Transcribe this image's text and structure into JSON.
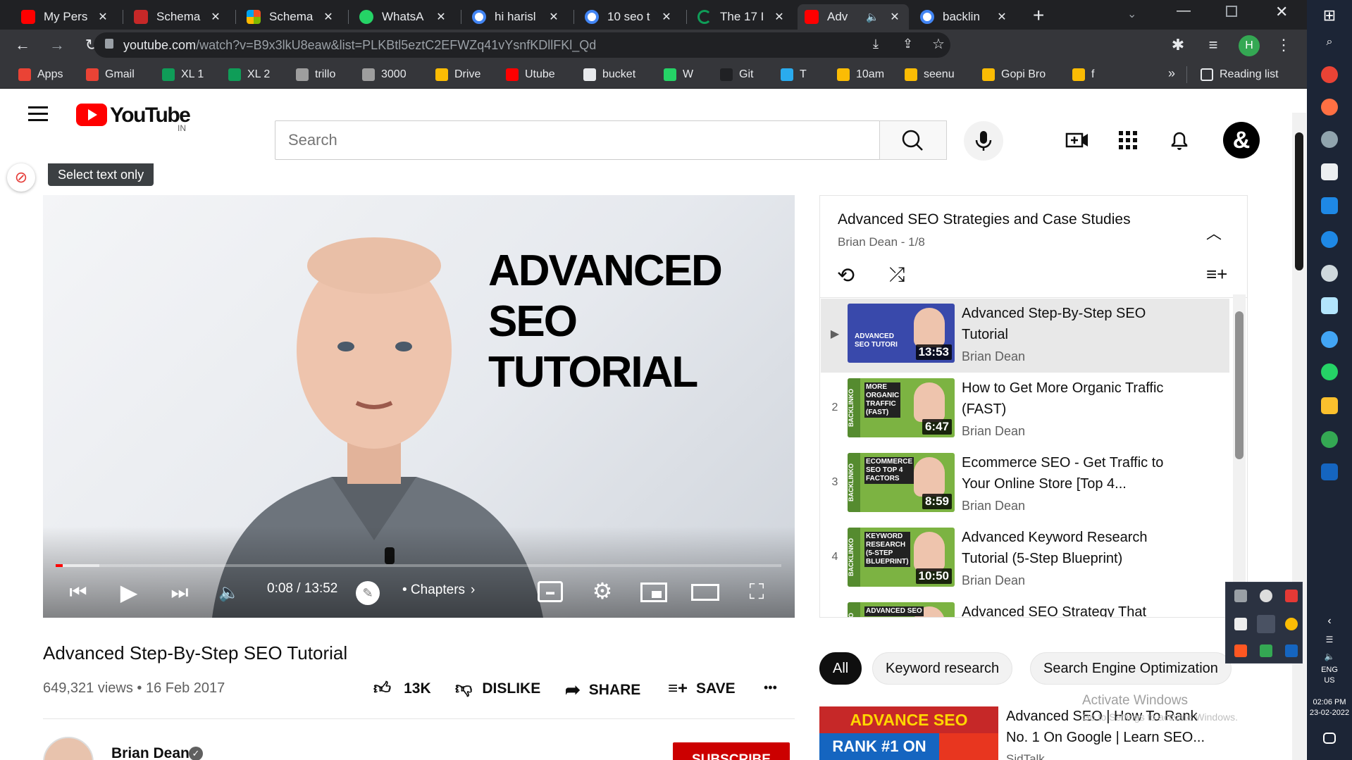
{
  "tabs": [
    {
      "title": "My Pers",
      "fav": "#ff0000"
    },
    {
      "title": "Schema",
      "fav": "#c00"
    },
    {
      "title": "Schema",
      "fav": "#f25022"
    },
    {
      "title": "WhatsA",
      "fav": "#25d366"
    },
    {
      "title": "hi harisl",
      "fav": "#4285f4"
    },
    {
      "title": "10 seo t",
      "fav": "#4285f4"
    },
    {
      "title": "The 17 I",
      "fav": "#0f9d58"
    },
    {
      "title": "Adv",
      "fav": "#ff0000"
    },
    {
      "title": "backlin",
      "fav": "#4285f4"
    }
  ],
  "address": {
    "host": "youtube.com",
    "path": "/watch?v=B9x3lkU8eaw&list=PLKBtl5eztC2EFWZq41vYsnfKDllFKl_Qd"
  },
  "profile_initial": "H",
  "bookmarks": [
    {
      "label": "Apps",
      "color": "#ea4335"
    },
    {
      "label": "Gmail",
      "color": "#ea4335"
    },
    {
      "label": "XL 1",
      "color": "#0f9d58"
    },
    {
      "label": "XL 2",
      "color": "#0f9d58"
    },
    {
      "label": "trillo",
      "color": "#9e9e9e"
    },
    {
      "label": "3000",
      "color": "#9e9e9e"
    },
    {
      "label": "Drive",
      "color": "#fbbc04"
    },
    {
      "label": "Utube",
      "color": "#ff0000"
    },
    {
      "label": "bucket",
      "color": "#e8eaed"
    },
    {
      "label": "W",
      "color": "#25d366"
    },
    {
      "label": "Git",
      "color": "#202124"
    },
    {
      "label": "T",
      "color": "#2aabee"
    },
    {
      "label": "10am",
      "color": "#fbbc04"
    },
    {
      "label": "seenu",
      "color": "#fbbc04"
    },
    {
      "label": "Gopi Bro",
      "color": "#fbbc04"
    },
    {
      "label": "f",
      "color": "#fbbc04"
    }
  ],
  "bookmarks_more": "»",
  "reading_list": "Reading list",
  "yt": {
    "logo": "YouTube",
    "region": "IN",
    "search_placeholder": "Search",
    "avatar": "&",
    "tooltip": "Select text only"
  },
  "player": {
    "headline": [
      "ADVANCED",
      "SEO",
      "TUTORIAL"
    ],
    "time": "0:08 / 13:52",
    "progress_fraction": 0.01,
    "buffered_fraction": 0.06,
    "chapters": "• Chapters"
  },
  "video": {
    "title": "Advanced Step-By-Step SEO Tutorial",
    "meta": "649,321 views • 16 Feb 2017",
    "likes": "13K",
    "dislike": "DISLIKE",
    "share": "SHARE",
    "save": "SAVE",
    "more": "•••",
    "channel": "Brian Dean",
    "subscribe": "SUBSCRIBE"
  },
  "playlist": {
    "title": "Advanced SEO Strategies and Case Studies",
    "sub": "Brian Dean - 1/8",
    "items": [
      {
        "idx": "▶",
        "title": "Advanced Step-By-Step SEO Tutorial",
        "author": "Brian Dean",
        "dur": "13:53",
        "thumb": [
          "ADVANCED",
          "SEO TUTORI"
        ]
      },
      {
        "idx": "2",
        "title": "How to Get More Organic Traffic (FAST)",
        "author": "Brian Dean",
        "dur": "6:47",
        "thumb": [
          "MORE",
          "ORGANIC",
          "TRAFFIC",
          "(FAST)"
        ]
      },
      {
        "idx": "3",
        "title": "Ecommerce SEO - Get Traffic to Your Online Store [Top 4...",
        "author": "Brian Dean",
        "dur": "8:59",
        "thumb": [
          "ECOMMERCE",
          "SEO TOP 4",
          "FACTORS"
        ]
      },
      {
        "idx": "4",
        "title": "Advanced Keyword Research Tutorial (5-Step Blueprint)",
        "author": "Brian Dean",
        "dur": "10:50",
        "thumb": [
          "KEYWORD",
          "RESEARCH",
          "(5-STEP",
          "BLUEPRINT)"
        ]
      },
      {
        "idx": "",
        "title": "Advanced SEO Strategy That",
        "author": "",
        "dur": "",
        "thumb": [
          "ADVANCED SEO"
        ]
      }
    ],
    "side_brand": "BACKLINKO"
  },
  "chips": [
    "All",
    "Keyword research",
    "Search Engine Optimization"
  ],
  "recommended": {
    "title": "Advanced SEO | How To Rank No. 1 On Google | Learn SEO...",
    "channel": "SidTalk",
    "thumb_line1": "ADVANCE SEO",
    "thumb_line2": "RANK #1 ON"
  },
  "watermark": {
    "line1": "Activate Windows",
    "line2": "Go to Settings to activate Windows."
  },
  "taskbar": {
    "lang1": "ENG",
    "lang2": "US",
    "time": "02:06 PM",
    "date": "23-02-2022"
  }
}
